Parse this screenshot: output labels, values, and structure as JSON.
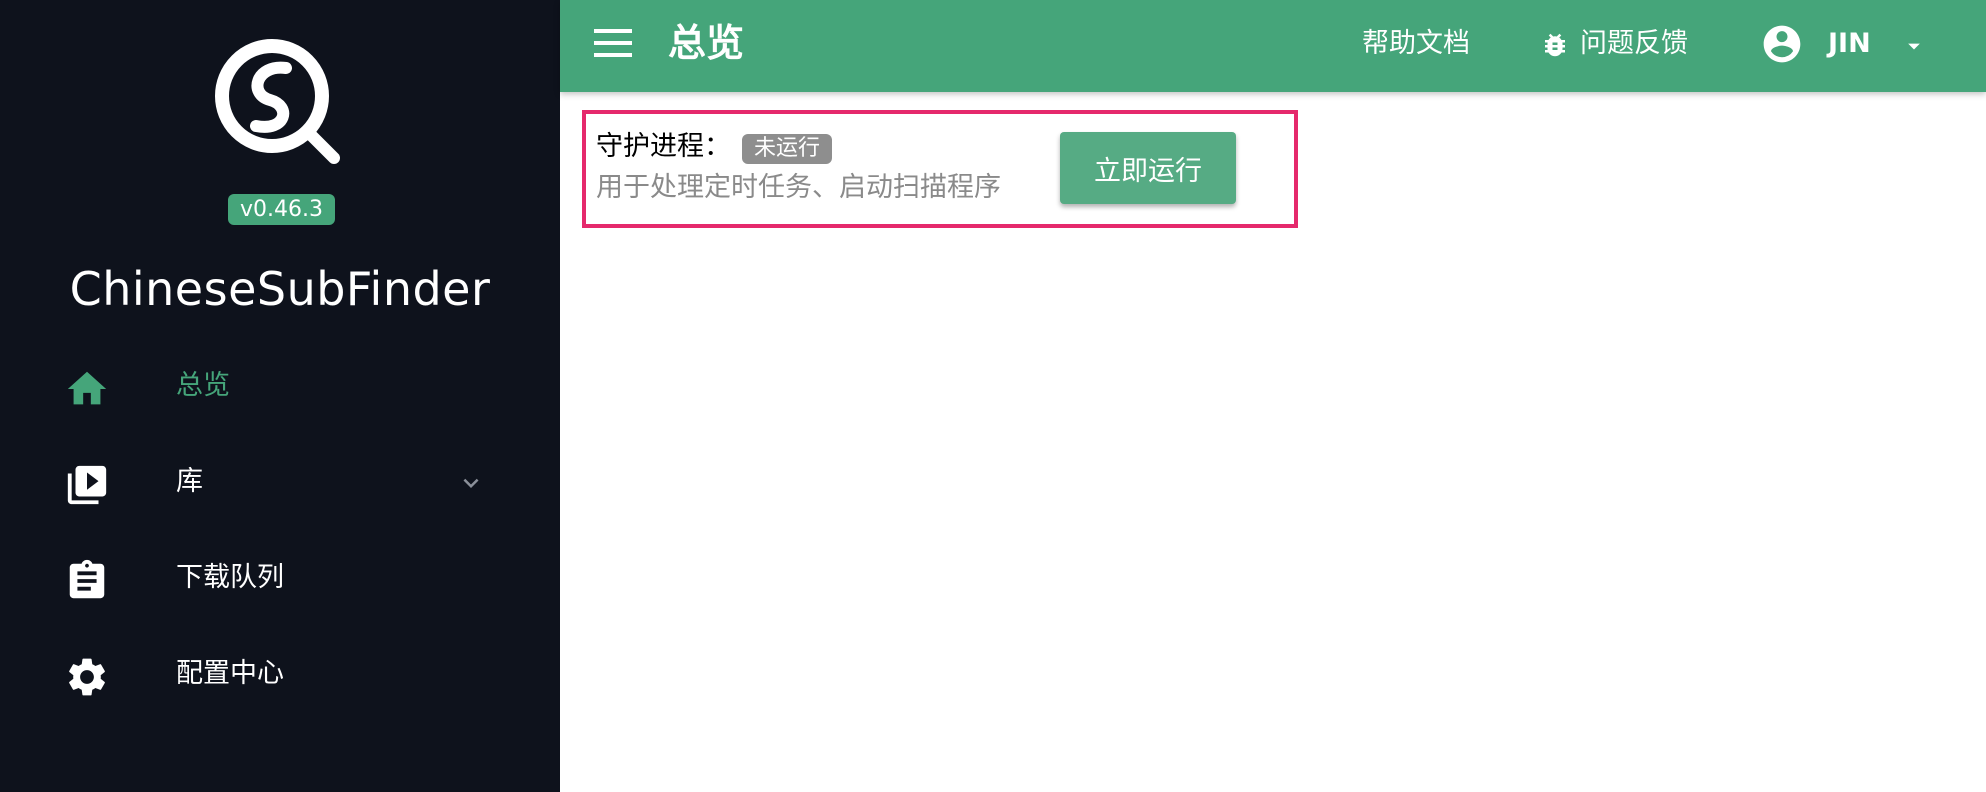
{
  "sidebar": {
    "version": "v0.46.3",
    "app_name": "ChineseSubFinder",
    "items": [
      {
        "label": "总览",
        "icon": "home-icon",
        "active": true
      },
      {
        "label": "库",
        "icon": "video-library-icon",
        "has_submenu": true
      },
      {
        "label": "下载队列",
        "icon": "clipboard-icon"
      },
      {
        "label": "配置中心",
        "icon": "gear-icon"
      }
    ]
  },
  "topbar": {
    "title": "总览",
    "help_label": "帮助文档",
    "feedback_label": "问题反馈",
    "user_name": "JIN"
  },
  "daemon": {
    "title": "守护进程：",
    "status": "未运行",
    "description": "用于处理定时任务、启动扫描程序",
    "run_button": "立即运行"
  },
  "colors": {
    "accent": "#45a57a",
    "sidebar_bg": "#0e121c",
    "highlight_border": "#e5296c",
    "status_badge_bg": "#8e8e8e"
  }
}
